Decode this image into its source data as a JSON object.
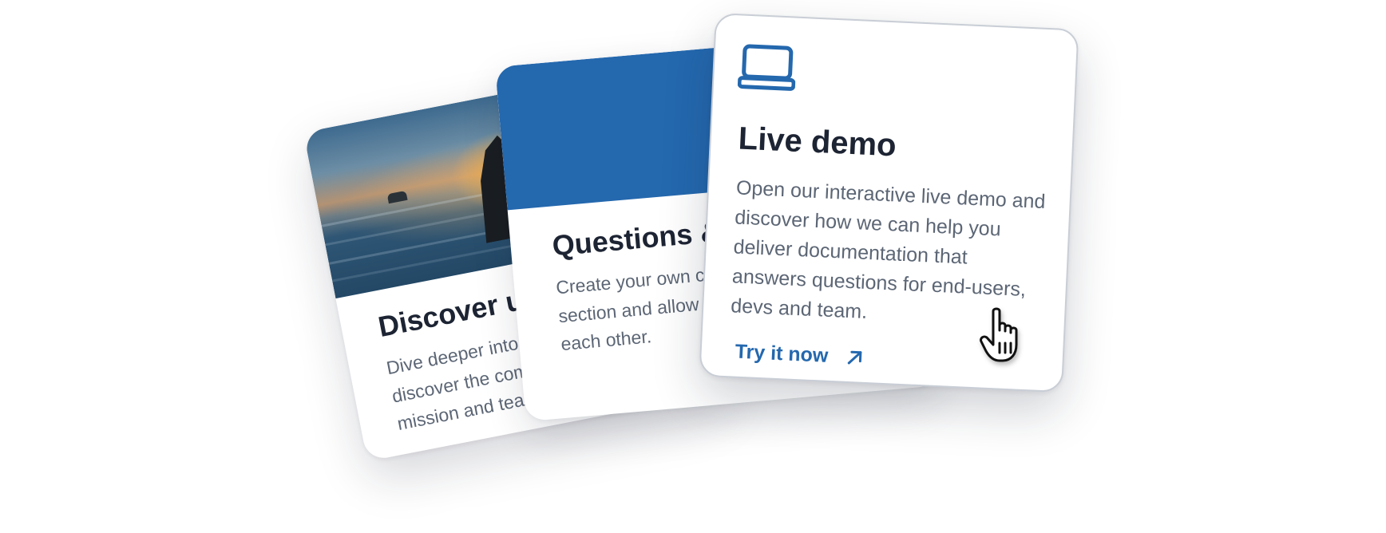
{
  "cards": [
    {
      "title": "Discover us",
      "text": "Dive deeper into the page and discover the company's history, mission and team members.",
      "media": "sunset-sea-stack-photo"
    },
    {
      "title": "Questions & Answers",
      "text": "Create your own community forum like section and allow your audience to help each other.",
      "band_color": "#2468ae"
    },
    {
      "title": "Live demo",
      "text": "Open our interactive live demo and discover how we can help you deliver documentation that answers questions for end-users, devs and team.",
      "icon": "laptop-icon",
      "cta": "Try it now",
      "cta_icon": "arrow-up-right-icon"
    }
  ],
  "colors": {
    "accent": "#2468ae",
    "title": "#1d2433",
    "body_text": "#5c6675",
    "card_border": "#c9ced6"
  },
  "cursor": "hand-pointer-cursor"
}
